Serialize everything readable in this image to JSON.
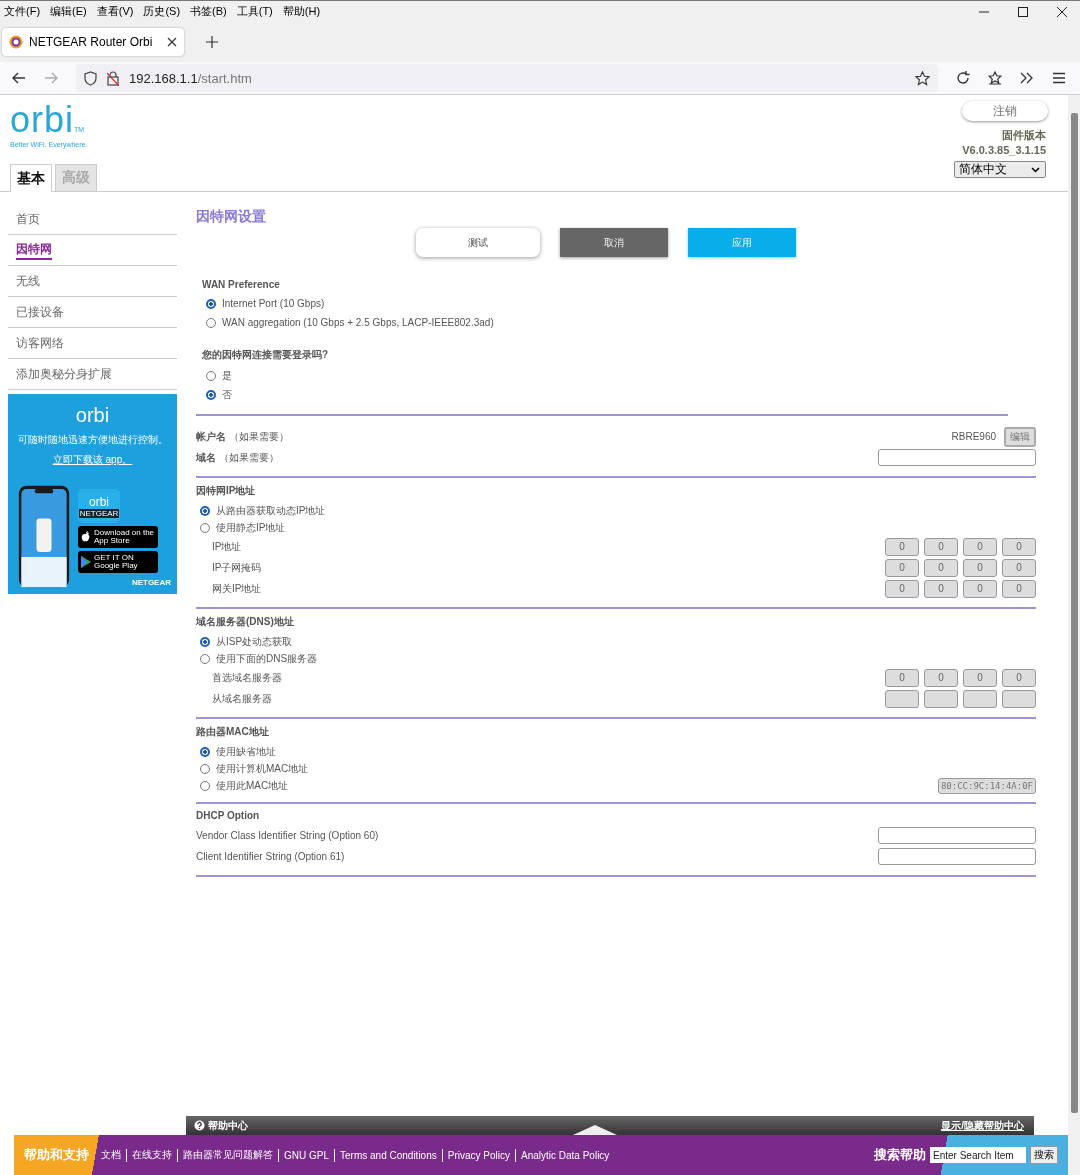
{
  "menu_bar": [
    "文件(F)",
    "编辑(E)",
    "查看(V)",
    "历史(S)",
    "书签(B)",
    "工具(T)",
    "帮助(H)"
  ],
  "browser": {
    "tab_title": "NETGEAR Router Orbi",
    "url_host": "192.168.1.1",
    "url_path": "/start.htm"
  },
  "header": {
    "logo": "orbi",
    "logo_mark": "TM",
    "tagline": "Better WiFi. Everywhere.",
    "logout": "注销",
    "firmware_label": "固件版本",
    "firmware_version": "V6.0.3.85_3.1.15",
    "language": "简体中文"
  },
  "tabs": [
    {
      "label": "基本",
      "selected": true
    },
    {
      "label": "高级",
      "selected": false
    }
  ],
  "sidebar": [
    {
      "label": "首页",
      "selected": false
    },
    {
      "label": "因特网",
      "selected": true
    },
    {
      "label": "无线",
      "selected": false
    },
    {
      "label": "已接设备",
      "selected": false
    },
    {
      "label": "访客网络",
      "selected": false
    },
    {
      "label": "添加奥秘分身扩展",
      "selected": false
    }
  ],
  "promo": {
    "logo": "orbi",
    "text": "可随时随地迅速方便地进行控制。",
    "link": "立即下载该 app。",
    "app_logo": "orbi",
    "app_brand": "NETGEAR",
    "app_store_small": "Download on the",
    "app_store": "App Store",
    "google_small": "GET IT ON",
    "google_play": "Google Play",
    "brand": "NETGEAR"
  },
  "content": {
    "title": "因特网设置",
    "buttons": [
      {
        "label": "测试",
        "kind": "test"
      },
      {
        "label": "取消",
        "kind": "cancel"
      },
      {
        "label": "应用",
        "kind": "apply"
      }
    ],
    "wan_preference": {
      "title": "WAN Preference",
      "options": [
        {
          "label": "Internet Port (10 Gbps)",
          "selected": true
        },
        {
          "label": "WAN aggregation (10 Gbps + 2.5 Gbps, LACP-IEEE802.3ad)",
          "selected": false
        }
      ]
    },
    "login_required": {
      "question": "您的因特网连接需要登录吗?",
      "options": [
        {
          "label": "是",
          "selected": false
        },
        {
          "label": "否",
          "selected": true
        }
      ]
    },
    "account": [
      {
        "label": "帐户名",
        "hint": "（如果需要）",
        "kind": "value",
        "value": "RBRE960",
        "button": "编辑"
      },
      {
        "label": "域名",
        "hint": "（如果需要）",
        "kind": "field"
      }
    ],
    "ip_address": {
      "title": "因特网IP地址",
      "options": [
        {
          "label": "从路由器获取动态IP地址",
          "selected": true
        },
        {
          "label": "使用静态IP地址",
          "selected": false
        }
      ],
      "fields": [
        {
          "label": "IP地址",
          "kind": "ip",
          "disabled": true,
          "octets": [
            "0",
            "0",
            "0",
            "0"
          ]
        },
        {
          "label": "IP子网掩码",
          "kind": "ip",
          "disabled": true,
          "octets": [
            "0",
            "0",
            "0",
            "0"
          ]
        },
        {
          "label": "网关IP地址",
          "kind": "ip",
          "disabled": true,
          "octets": [
            "0",
            "0",
            "0",
            "0"
          ]
        }
      ]
    },
    "dns": {
      "title": "域名服务器(DNS)地址",
      "options": [
        {
          "label": "从ISP处动态获取",
          "selected": true
        },
        {
          "label": "使用下面的DNS服务器",
          "selected": false
        }
      ],
      "fields": [
        {
          "label": "首选域名服务器",
          "kind": "ip",
          "disabled": true,
          "octets": [
            "0",
            "0",
            "0",
            "0"
          ]
        },
        {
          "label": "从域名服务器",
          "kind": "blank_ip",
          "disabled": true
        }
      ]
    },
    "mac": {
      "title": "路由器MAC地址",
      "options": [
        {
          "label": "使用缺省地址",
          "selected": true
        },
        {
          "label": "使用计算机MAC地址",
          "selected": false
        },
        {
          "label": "使用此MAC地址",
          "selected": false
        }
      ],
      "value": "80:CC:9C:14:4A:0F",
      "disabled": true
    },
    "dhcp": {
      "title": "DHCP Option",
      "fields": [
        {
          "label": "Vendor Class Identifier String (Option 60)"
        },
        {
          "label": "Client Identifier String (Option 61)"
        }
      ]
    }
  },
  "help_bar": {
    "label": "帮助中心",
    "toggle": "显示/隐藏帮助中心"
  },
  "footer": {
    "title": "帮助和支持",
    "links": [
      "文档",
      "在线支持",
      "路由器常见问题解答",
      "GNU GPL",
      "Terms and Conditions",
      "Privacy Policy",
      "Analytic Data Policy"
    ],
    "search_label": "搜索帮助",
    "search_placeholder": "Enter Search Item",
    "search_button": "搜索"
  }
}
